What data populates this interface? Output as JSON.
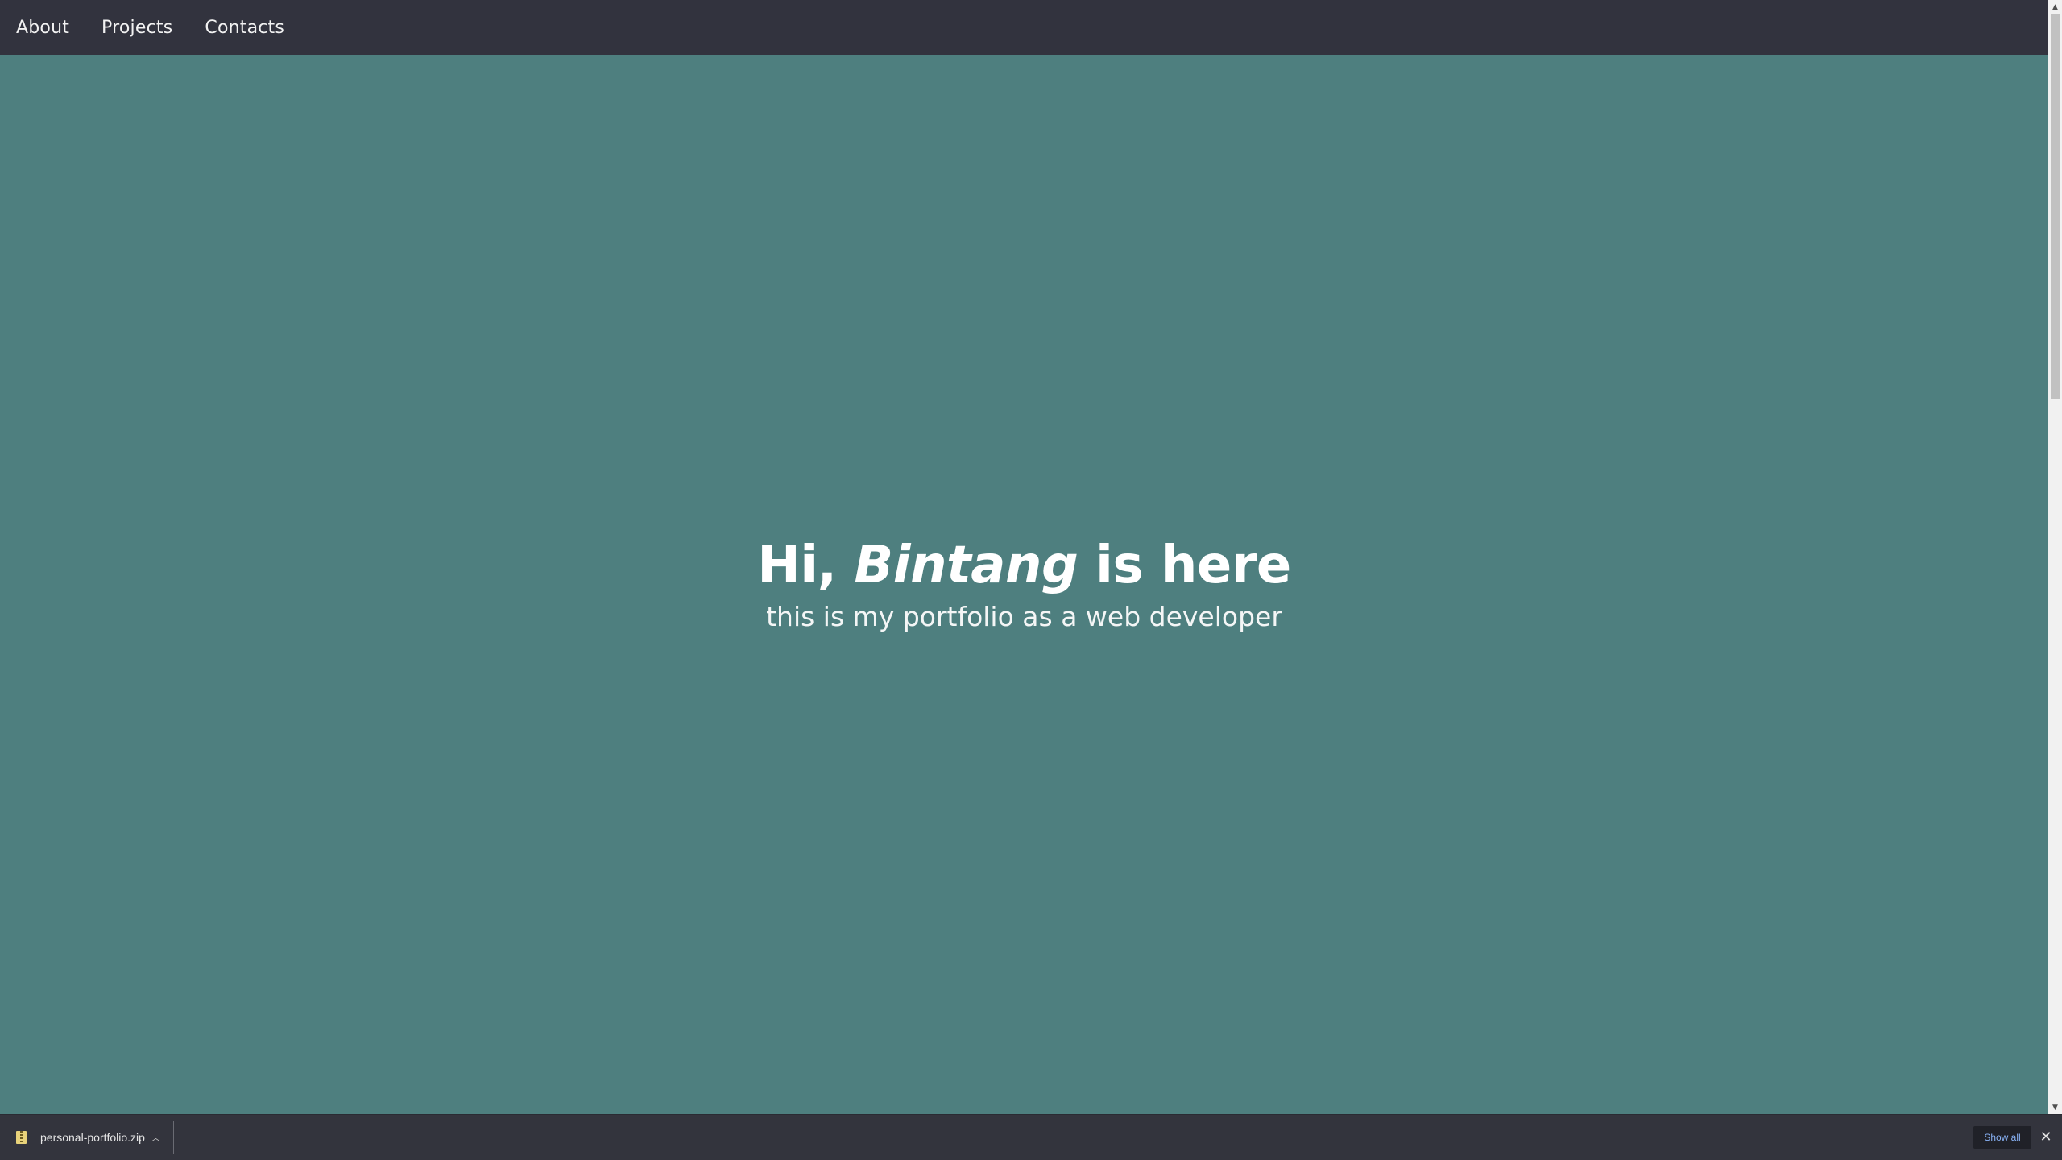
{
  "nav": {
    "items": [
      {
        "label": "About"
      },
      {
        "label": "Projects"
      },
      {
        "label": "Contacts"
      }
    ]
  },
  "hero": {
    "greeting": "Hi,",
    "name": "Bintang",
    "suffix": "is here",
    "subtitle": "this is my portfolio as a web developer"
  },
  "download_shelf": {
    "file_name": "personal-portfolio.zip",
    "show_all_label": "Show all",
    "file_icon": "zip-file-icon",
    "menu_icon": "chevron-up-icon",
    "close_icon": "close-icon"
  },
  "colors": {
    "navbar_bg": "#32333e",
    "hero_bg": "#4e7f7f",
    "text": "#ffffff",
    "shelf_bg": "#33343d",
    "show_all_text": "#8ab4f8"
  }
}
